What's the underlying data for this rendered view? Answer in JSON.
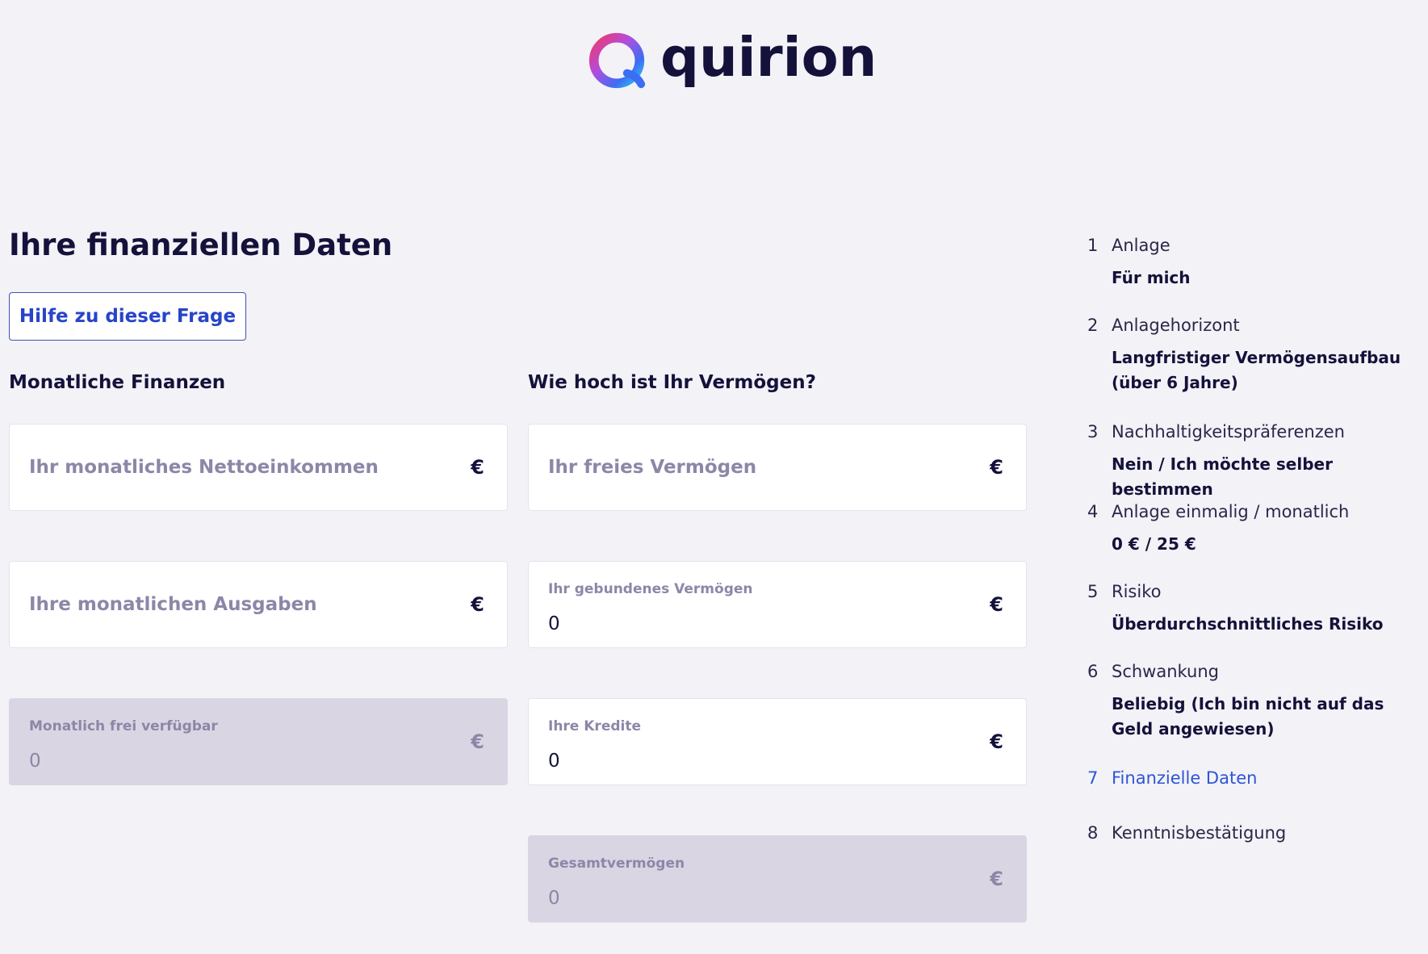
{
  "brand": {
    "name": "quirion",
    "accent": "#2844c8",
    "gradient": [
      "#f0386b",
      "#b14de0",
      "#3d6df2",
      "#2cc3f0"
    ]
  },
  "page": {
    "title": "Ihre finanziellen Daten",
    "help_button": "Hilfe zu dieser Frage"
  },
  "monthly": {
    "title": "Monatliche Finanzen",
    "net_income": {
      "placeholder": "Ihr monatliches Nettoeinkommen",
      "currency": "€"
    },
    "expenses": {
      "placeholder": "Ihre monatlichen Ausgaben",
      "currency": "€"
    },
    "free": {
      "label": "Monatlich frei verfügbar",
      "value": "0",
      "currency": "€"
    }
  },
  "assets": {
    "title": "Wie hoch ist Ihr Vermögen?",
    "free_assets": {
      "placeholder": "Ihr freies Vermögen",
      "currency": "€"
    },
    "bound_assets": {
      "label": "Ihr gebundenes Vermögen",
      "value": "0",
      "currency": "€"
    },
    "credits": {
      "label": "Ihre Kredite",
      "value": "0",
      "currency": "€"
    },
    "total": {
      "label": "Gesamtvermögen",
      "value": "0",
      "currency": "€"
    }
  },
  "steps": [
    {
      "num": "1",
      "title": "Anlage",
      "value": "Für mich"
    },
    {
      "num": "2",
      "title": "Anlagehorizont",
      "value": "Langfristiger Vermögensaufbau (über 6 Jahre)"
    },
    {
      "num": "3",
      "title": "Nachhaltigkeitspräferenzen",
      "value": "Nein / Ich möchte selber bestimmen"
    },
    {
      "num": "4",
      "title": "Anlage einmalig / monatlich",
      "value": "0 € / 25 €"
    },
    {
      "num": "5",
      "title": "Risiko",
      "value": "Überdurchschnittliches Risiko"
    },
    {
      "num": "6",
      "title": "Schwankung",
      "value": "Beliebig (Ich bin nicht auf das Geld angewiesen)"
    },
    {
      "num": "7",
      "title": "Finanzielle Daten",
      "value": ""
    },
    {
      "num": "8",
      "title": "Kenntnisbestätigung",
      "value": ""
    }
  ]
}
